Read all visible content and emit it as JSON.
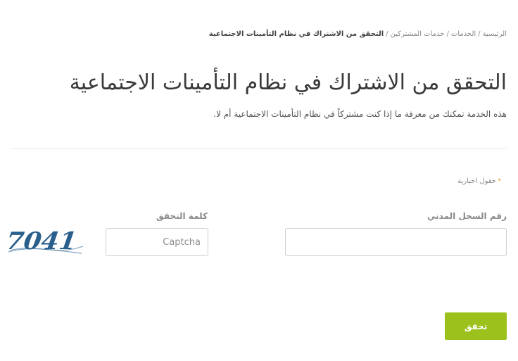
{
  "breadcrumb": {
    "items": [
      "الرئيسية",
      "الخدمات",
      "خدمات المشتركين"
    ],
    "separator": "/",
    "current": "التحقق من الاشتراك في نظام التأمينات الاجتماعية"
  },
  "page": {
    "title": "التحقق من الاشتراك في نظام التأمينات الاجتماعية",
    "description": "هذه الخدمة تمكنك من معرفة ما إذا كنت مشتركاً في نظام التأمينات الاجتماعية أم لا."
  },
  "form": {
    "required_note": "حقول اجبارية",
    "required_star": "*",
    "civil_id": {
      "label": "رقم السجل المدني",
      "value": "",
      "placeholder": ""
    },
    "captcha": {
      "label": "كلمة التحقق",
      "value": "",
      "placeholder": "Captcha",
      "image_text": "7041"
    },
    "submit_label": "تحقق"
  },
  "colors": {
    "accent": "#9cc11c",
    "required_star": "#e8a33a",
    "captcha_text": "#2a5f8c"
  }
}
